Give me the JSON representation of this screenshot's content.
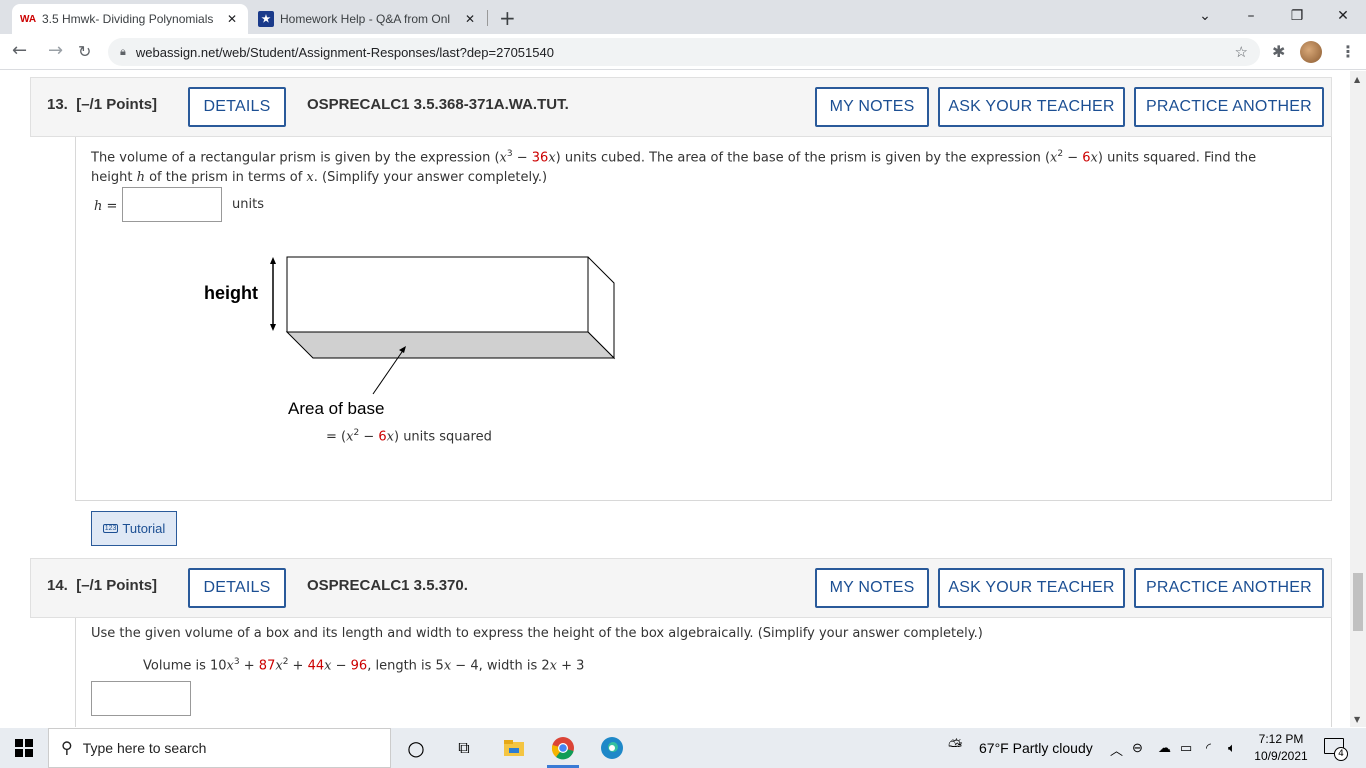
{
  "browser": {
    "tabs": [
      {
        "title": "3.5 Hmwk- Dividing Polynomials",
        "favicon": "WA",
        "active": true
      },
      {
        "title": "Homework Help - Q&A from Onl",
        "favicon": "star",
        "active": false
      }
    ],
    "new_tab": "+",
    "url": "webassign.net/web/Student/Assignment-Responses/last?dep=27051540",
    "window_controls": {
      "minimize": "–",
      "restore": "❐",
      "close": "✕",
      "tab_search": "⌄"
    }
  },
  "questions": [
    {
      "number": "13.",
      "points": "[–/1 Points]",
      "details_label": "DETAILS",
      "code": "OSPRECALC1 3.5.368-371A.WA.TUT.",
      "my_notes_label": "MY NOTES",
      "ask_teacher_label": "ASK YOUR TEACHER",
      "practice_label": "PRACTICE ANOTHER",
      "prompt_parts": {
        "p1": "The volume of a rectangular prism is given by the expression  (",
        "x3": "x",
        "exp3": "3",
        "minus1": " − ",
        "c36": "36",
        "x1": "x",
        "p2": ")  units cubed. The area of the base of the prism is given by the expression  (",
        "x2": "x",
        "exp2": "2",
        "minus2": " − ",
        "c6": "6",
        "x4": "x",
        "p3": ")  units squared. Find the",
        "p4": "height ",
        "h": "h",
        "p5": " of the prism in terms of ",
        "xv": "x",
        "p6": ". (Simplify your answer completely.)"
      },
      "answer_label": "h =",
      "answer_value": "",
      "answer_unit": "units",
      "figure": {
        "height_label": "height",
        "base_label": "Area of base",
        "base_expr_prefix": "= (",
        "base_expr_x": "x",
        "base_expr_exp": "2",
        "base_expr_minus": " − ",
        "base_expr_coef": "6",
        "base_expr_x2": "x",
        "base_expr_suffix": ") units squared"
      },
      "tutorial_label": "Tutorial",
      "tutorial_icon": "123"
    },
    {
      "number": "14.",
      "points": "[–/1 Points]",
      "details_label": "DETAILS",
      "code": "OSPRECALC1 3.5.370.",
      "my_notes_label": "MY NOTES",
      "ask_teacher_label": "ASK YOUR TEACHER",
      "practice_label": "PRACTICE ANOTHER",
      "prompt": "Use the given volume of a box and its length and width to express the height of the box algebraically. (Simplify your answer completely.)",
      "given": {
        "vol_label": "Volume is  10",
        "t1x": "x",
        "t1e": "3",
        "plus1": " + ",
        "t2c": "87",
        "t2x": "x",
        "t2e": "2",
        "plus2": " + ",
        "t3c": "44",
        "t3x": "x",
        "minus": " − ",
        "t4": "96",
        "len_label": ",  length is  5",
        "len_x": "x",
        "len_rest": " − 4,  width is  2",
        "wid_x": "x",
        "wid_rest": " + 3"
      },
      "answer_value": ""
    }
  ],
  "taskbar": {
    "search_placeholder": "Type here to search",
    "weather": "67°F  Partly cloudy",
    "time": "7:12 PM",
    "date": "10/9/2021",
    "notifications": "4"
  }
}
